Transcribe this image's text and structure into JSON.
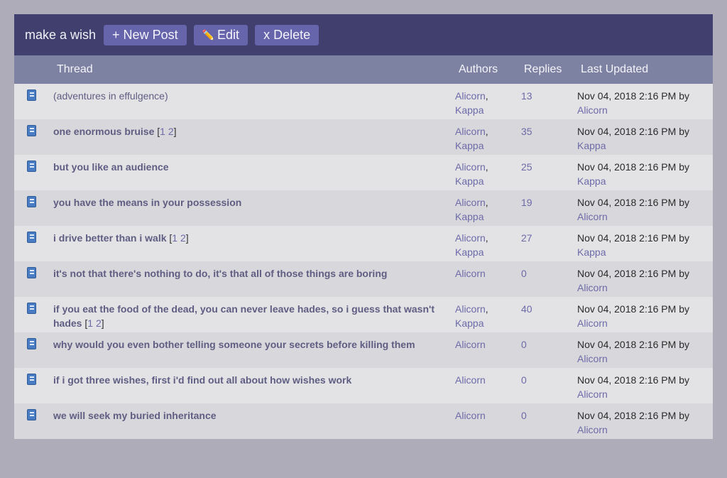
{
  "board": {
    "title": "make a wish",
    "buttons": {
      "new_post": "+ New Post",
      "edit": "Edit",
      "delete": "x Delete"
    }
  },
  "columns": {
    "thread": "Thread",
    "authors": "Authors",
    "replies": "Replies",
    "updated": "Last Updated"
  },
  "threads": [
    {
      "title": "(adventures in effulgence)",
      "pages": [],
      "authors": [
        "Alicorn",
        "Kappa"
      ],
      "replies": "13",
      "date": "Nov 04, 2018 2:16 PM by",
      "by": "Alicorn"
    },
    {
      "title": "one enormous bruise",
      "pages": [
        "1",
        "2"
      ],
      "authors": [
        "Alicorn",
        "Kappa"
      ],
      "replies": "35",
      "date": "Nov 04, 2018 2:16 PM by",
      "by": "Kappa"
    },
    {
      "title": "but you like an audience",
      "pages": [],
      "authors": [
        "Alicorn",
        "Kappa"
      ],
      "replies": "25",
      "date": "Nov 04, 2018 2:16 PM by",
      "by": "Kappa"
    },
    {
      "title": "you have the means in your possession",
      "pages": [],
      "authors": [
        "Alicorn",
        "Kappa"
      ],
      "replies": "19",
      "date": "Nov 04, 2018 2:16 PM by",
      "by": "Alicorn"
    },
    {
      "title": "i drive better than i walk",
      "pages": [
        "1",
        "2"
      ],
      "authors": [
        "Alicorn",
        "Kappa"
      ],
      "replies": "27",
      "date": "Nov 04, 2018 2:16 PM by",
      "by": "Kappa"
    },
    {
      "title": "it's not that there's nothing to do, it's that all of those things are boring",
      "pages": [],
      "authors": [
        "Alicorn"
      ],
      "replies": "0",
      "date": "Nov 04, 2018 2:16 PM by",
      "by": "Alicorn"
    },
    {
      "title": "if you eat the food of the dead, you can never leave hades, so i guess that wasn't hades",
      "pages": [
        "1",
        "2"
      ],
      "authors": [
        "Alicorn",
        "Kappa"
      ],
      "replies": "40",
      "date": "Nov 04, 2018 2:16 PM by",
      "by": "Alicorn"
    },
    {
      "title": "why would you even bother telling someone your secrets before killing them",
      "pages": [],
      "authors": [
        "Alicorn"
      ],
      "replies": "0",
      "date": "Nov 04, 2018 2:16 PM by",
      "by": "Alicorn"
    },
    {
      "title": "if i got three wishes, first i'd find out all about how wishes work",
      "pages": [],
      "authors": [
        "Alicorn"
      ],
      "replies": "0",
      "date": "Nov 04, 2018 2:16 PM by",
      "by": "Alicorn"
    },
    {
      "title": "we will seek my buried inheritance",
      "pages": [],
      "authors": [
        "Alicorn"
      ],
      "replies": "0",
      "date": "Nov 04, 2018 2:16 PM by",
      "by": "Alicorn"
    }
  ]
}
